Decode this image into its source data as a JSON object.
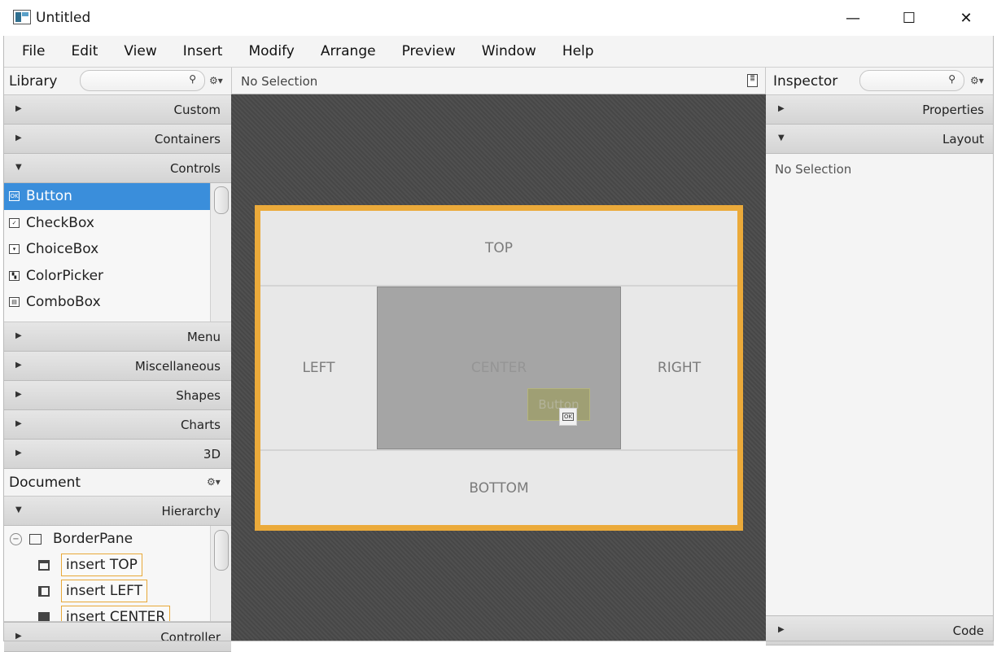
{
  "window": {
    "title": "Untitled",
    "minimize": "—",
    "maximize": "☐",
    "close": "✕"
  },
  "menubar": [
    "File",
    "Edit",
    "View",
    "Insert",
    "Modify",
    "Arrange",
    "Preview",
    "Window",
    "Help"
  ],
  "library": {
    "title": "Library",
    "search_icon": "⚲",
    "settings_icon": "⚙▾",
    "sections_top": [
      {
        "label": "Custom",
        "expanded": false
      },
      {
        "label": "Containers",
        "expanded": false
      },
      {
        "label": "Controls",
        "expanded": true
      }
    ],
    "controls": [
      {
        "label": "Button",
        "icon": "OK",
        "selected": true
      },
      {
        "label": "CheckBox",
        "icon": "✓",
        "selected": false
      },
      {
        "label": "ChoiceBox",
        "icon": "▾",
        "selected": false
      },
      {
        "label": "ColorPicker",
        "icon": "▚",
        "selected": false
      },
      {
        "label": "ComboBox",
        "icon": "▤",
        "selected": false
      }
    ],
    "sections_bottom": [
      {
        "label": "Menu"
      },
      {
        "label": "Miscellaneous"
      },
      {
        "label": "Shapes"
      },
      {
        "label": "Charts"
      },
      {
        "label": "3D"
      }
    ]
  },
  "document": {
    "title": "Document",
    "settings_icon": "⚙▾",
    "hierarchy_label": "Hierarchy",
    "root": "BorderPane",
    "children": [
      "insert TOP",
      "insert LEFT",
      "insert CENTER"
    ],
    "controller_label": "Controller"
  },
  "center": {
    "selection": "No Selection",
    "regions": {
      "top": "TOP",
      "left": "LEFT",
      "center": "CENTER",
      "right": "RIGHT",
      "bottom": "BOTTOM"
    },
    "drag_button_label": "Button",
    "drag_icon": "OK"
  },
  "inspector": {
    "title": "Inspector",
    "settings_icon": "⚙▾",
    "sections": [
      {
        "label": "Properties",
        "expanded": false
      },
      {
        "label": "Layout",
        "expanded": true
      }
    ],
    "content": "No Selection",
    "code_label": "Code"
  },
  "colors": {
    "selection": "#3a8edb",
    "pane_border": "#ebaa3a",
    "canvas": "#4a4a4a"
  }
}
